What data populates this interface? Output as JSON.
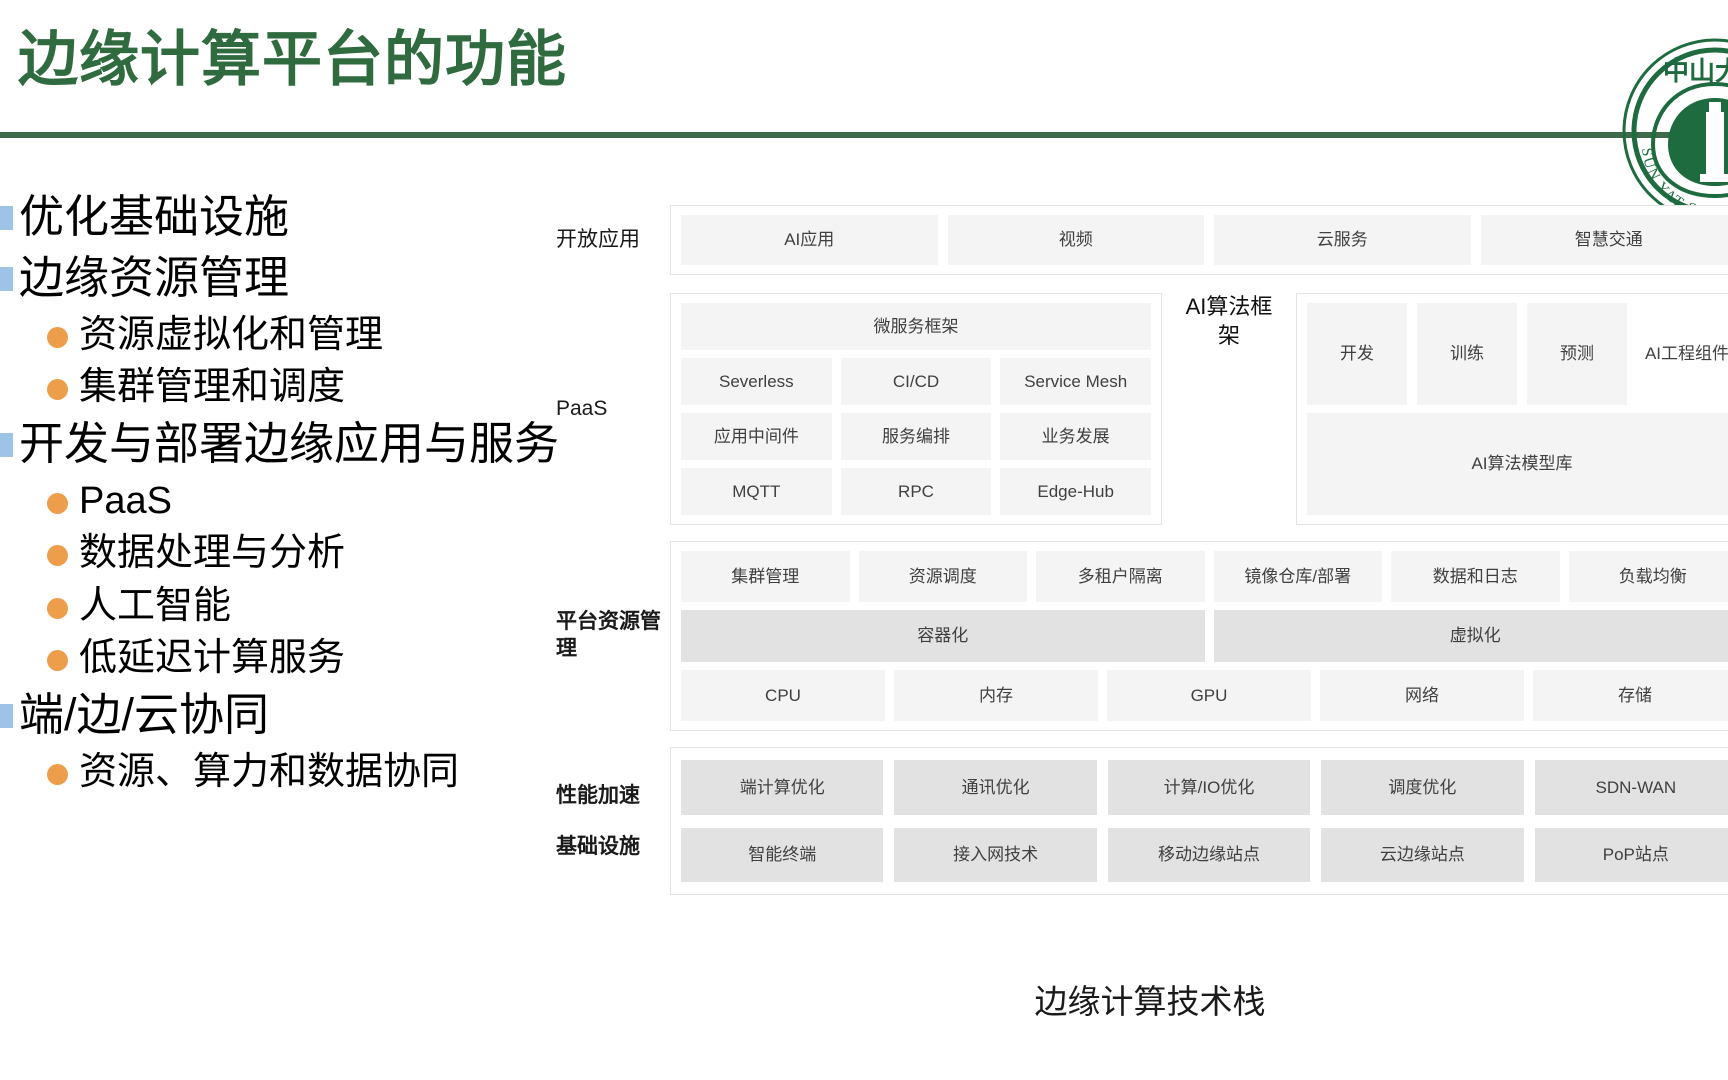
{
  "slide": {
    "title": "边缘计算平台的功能",
    "title_color": "#2f6b3f",
    "rule_color": "#3d6b4a",
    "caption": "边缘计算技术栈"
  },
  "logo": {
    "name": "sun-yat-sen-university-logo",
    "chinese_text": "中山大学",
    "english_text": "SUN YAT-SEN UNIV",
    "color": "#1d6b3f"
  },
  "outline": {
    "level1_bullet_color": "#9dc3e6",
    "level2_bullet_color": "#ed9e4b",
    "items": [
      {
        "level": 1,
        "text": "优化基础设施"
      },
      {
        "level": 1,
        "text": "边缘资源管理"
      },
      {
        "level": 2,
        "text": "资源虚拟化和管理"
      },
      {
        "level": 2,
        "text": "集群管理和调度"
      },
      {
        "level": 1,
        "text": "开发与部署边缘应用与服务"
      },
      {
        "level": 2,
        "text": "PaaS"
      },
      {
        "level": 2,
        "text": "数据处理与分析"
      },
      {
        "level": 2,
        "text": "人工智能"
      },
      {
        "level": 2,
        "text": "低延迟计算服务"
      },
      {
        "level": 1,
        "text": "端/边/云协同"
      },
      {
        "level": 2,
        "text": "资源、算力和数据协同"
      }
    ]
  },
  "diagram": {
    "apps": {
      "label": "开放应用",
      "cells": [
        "AI应用",
        "视频",
        "云服务",
        "智慧交通"
      ]
    },
    "paas": {
      "label": "PaaS",
      "left": {
        "header": "微服务框架",
        "rows": [
          [
            "Severless",
            "CI/CD",
            "Service Mesh"
          ],
          [
            "应用中间件",
            "服务编排",
            "业务发展"
          ],
          [
            "MQTT",
            "RPC",
            "Edge-Hub"
          ]
        ]
      },
      "middle": "AI算法框架",
      "right": {
        "rows": [
          [
            "开发",
            "训练",
            "预测",
            "AI工程组件"
          ],
          [
            "AI算法模型库"
          ]
        ]
      }
    },
    "platform": {
      "label": "平台资源管理",
      "rows": [
        [
          "集群管理",
          "资源调度",
          "多租户隔离",
          "镜像仓库/部署",
          "数据和日志",
          "负载均衡"
        ],
        [
          "容器化",
          "虚拟化"
        ],
        [
          "CPU",
          "内存",
          "GPU",
          "网络",
          "存储"
        ]
      ]
    },
    "infra": {
      "label_top": "性能加速",
      "label_bottom": "基础设施",
      "rows": [
        [
          "端计算优化",
          "通讯优化",
          "计算/IO优化",
          "调度优化",
          "SDN-WAN"
        ],
        [
          "智能终端",
          "接入网技术",
          "移动边缘站点",
          "云边缘站点",
          "PoP站点"
        ]
      ]
    }
  }
}
